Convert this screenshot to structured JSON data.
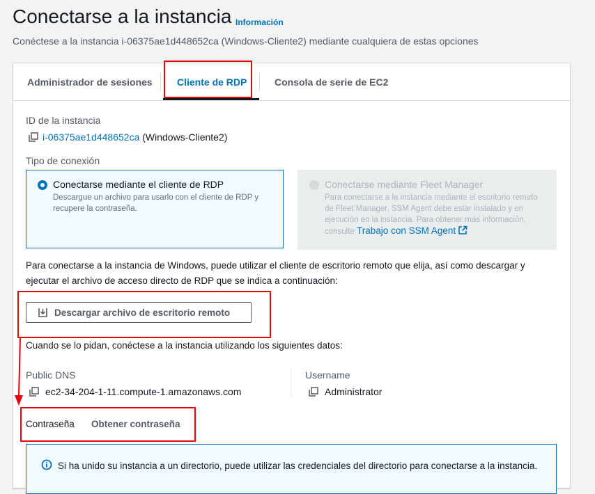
{
  "header": {
    "title": "Conectarse a la instancia",
    "info_link": "Información",
    "subtitle": "Conéctese a la instancia i-06375ae1d448652ca (Windows-Cliente2) mediante cualquiera de estas opciones"
  },
  "tabs": [
    {
      "label": "Administrador de sesiones"
    },
    {
      "label": "Cliente de RDP"
    },
    {
      "label": "Consola de serie de EC2"
    }
  ],
  "instance": {
    "label": "ID de la instancia",
    "id": "i-06375ae1d448652ca",
    "name": "(Windows-Cliente2)"
  },
  "connection_type": {
    "label": "Tipo de conexión",
    "rdp": {
      "title": "Conectarse mediante el cliente de RDP",
      "desc": "Descargue un archivo para usarlo con el cliente de RDP y recupere la contraseña."
    },
    "fleet": {
      "title": "Conectarse mediante Fleet Manager",
      "desc": "Para conectarse a la instancia mediante el escritorio remoto de Fleet Manager, SSM Agent debe estar instalado y en ejecución en la instancia. Para obtener más información, consulte",
      "link": "Trabajo con SSM Agent"
    }
  },
  "instructions": "Para conectarse a la instancia de Windows, puede utilizar el cliente de escritorio remoto que elija, así como descargar y ejecutar el archivo de acceso directo de RDP que se indica a continuación:",
  "download_button": "Descargar archivo de escritorio remoto",
  "prompt_text": "Cuando se lo pidan, conéctese a la instancia utilizando los siguientes datos:",
  "public_dns": {
    "label": "Public DNS",
    "value": "ec2-34-204-1-11.compute-1.amazonaws.com"
  },
  "username": {
    "label": "Username",
    "value": "Administrator"
  },
  "password": {
    "label": "Contraseña",
    "action": "Obtener contraseña"
  },
  "info_box": {
    "text": "Si ha unido su instancia a un directorio, puede utilizar las credenciales del directorio para conectarse a la instancia."
  },
  "colors": {
    "accent": "#0073bb",
    "annotation": "#e3050b"
  }
}
